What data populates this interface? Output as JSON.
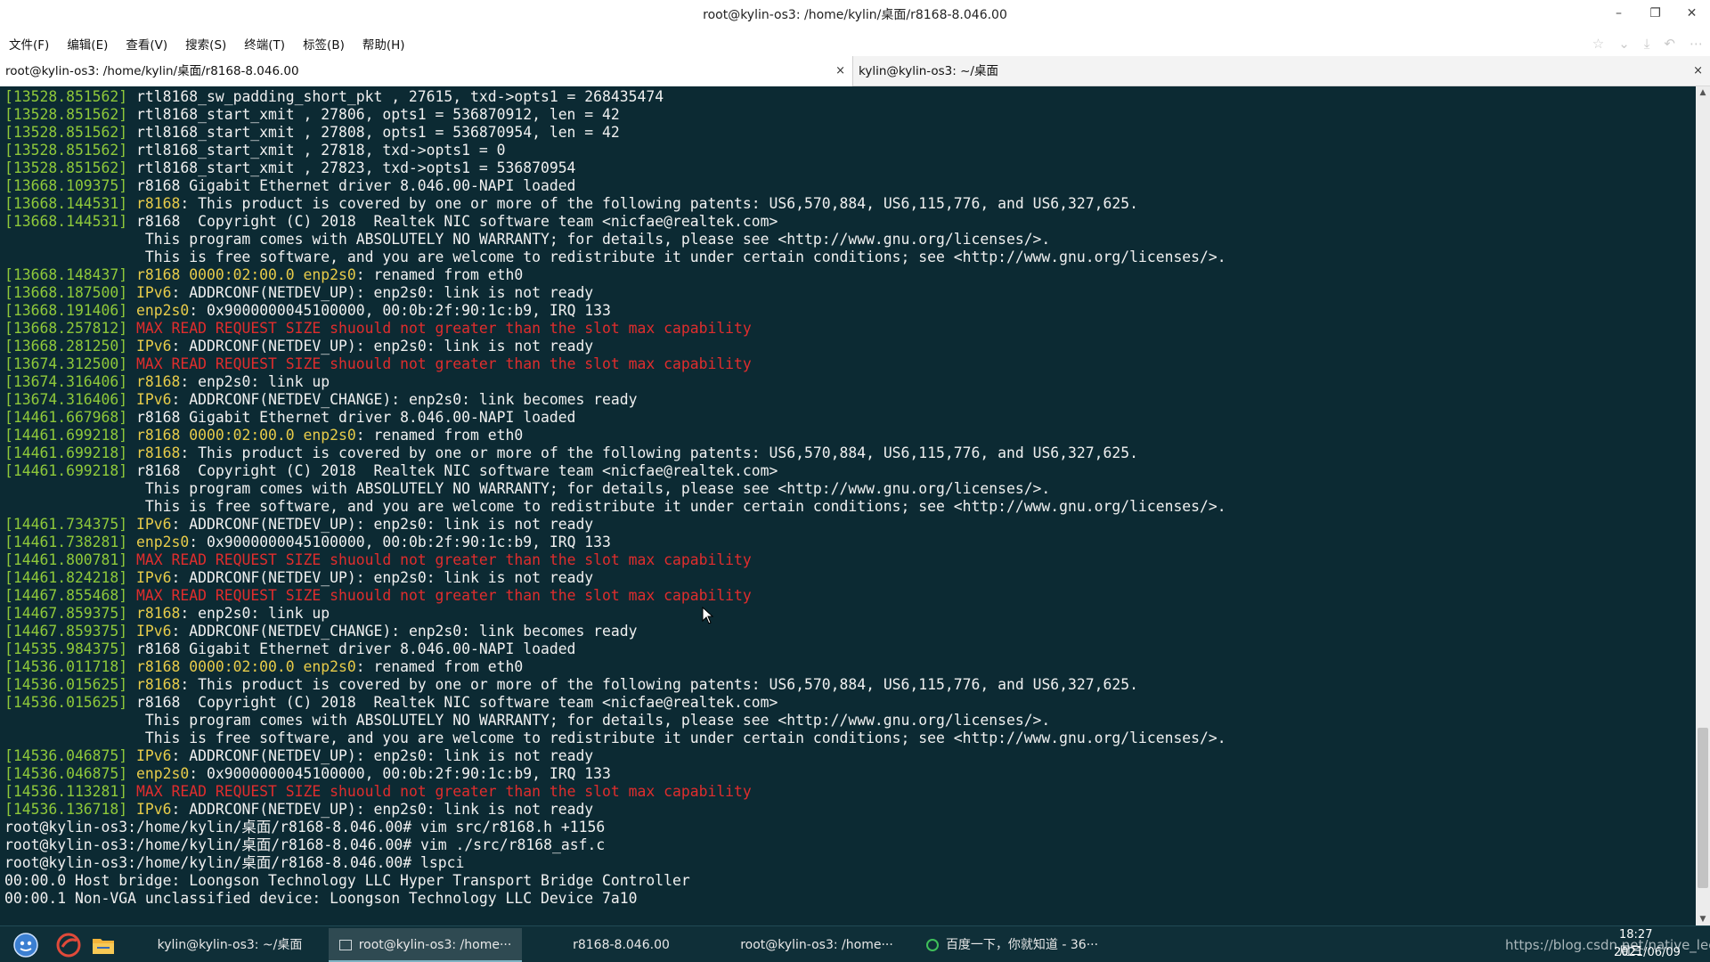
{
  "window": {
    "title": "root@kylin-os3: /home/kylin/桌面/r8168-8.046.00",
    "controls": {
      "minimize": "–",
      "restore": "❐",
      "close": "✕"
    }
  },
  "menu": [
    "文件(F)",
    "编辑(E)",
    "查看(V)",
    "搜索(S)",
    "终端(T)",
    "标签(B)",
    "帮助(H)"
  ],
  "tabs": [
    {
      "label": "root@kylin-os3: /home/kylin/桌面/r8168-8.046.00",
      "active": true
    },
    {
      "label": "kylin@kylin-os3: ~/桌面",
      "active": false
    }
  ],
  "terminal_lines": [
    [
      [
        "ts",
        "[13528.851562]"
      ],
      [
        "t",
        " rtl8168_sw_padding_short_pkt , 27615, txd->opts1 = 268435474"
      ]
    ],
    [
      [
        "ts",
        "[13528.851562]"
      ],
      [
        "t",
        " rtl8168_start_xmit , 27806, opts1 = 536870912, len = 42"
      ]
    ],
    [
      [
        "ts",
        "[13528.851562]"
      ],
      [
        "t",
        " rtl8168_start_xmit , 27808, opts1 = 536870954, len = 42"
      ]
    ],
    [
      [
        "ts",
        "[13528.851562]"
      ],
      [
        "t",
        " rtl8168_start_xmit , 27818, txd->opts1 = 0"
      ]
    ],
    [
      [
        "ts",
        "[13528.851562]"
      ],
      [
        "t",
        " rtl8168_start_xmit , 27823, txd->opts1 = 536870954"
      ]
    ],
    [
      [
        "ts",
        "[13668.109375]"
      ],
      [
        "t",
        " r8168 Gigabit Ethernet driver 8.046.00-NAPI loaded"
      ]
    ],
    [
      [
        "ts",
        "[13668.144531]"
      ],
      [
        "t",
        " "
      ],
      [
        "kw",
        "r8168"
      ],
      [
        "t",
        ": This product is covered by one or more of the following patents: US6,570,884, US6,115,776, and US6,327,625."
      ]
    ],
    [
      [
        "ts",
        "[13668.144531]"
      ],
      [
        "t",
        " r8168  Copyright (C) 2018  Realtek NIC software team <nicfae@realtek.com>"
      ]
    ],
    [
      [
        "t",
        "                This program comes with ABSOLUTELY NO WARRANTY; for details, please see <http://www.gnu.org/licenses/>."
      ]
    ],
    [
      [
        "t",
        "                This is free software, and you are welcome to redistribute it under certain conditions; see <http://www.gnu.org/licenses/>."
      ]
    ],
    [
      [
        "ts",
        "[13668.148437]"
      ],
      [
        "t",
        " "
      ],
      [
        "kw",
        "r8168 0000:02:00.0 enp2s0"
      ],
      [
        "t",
        ": renamed from eth0"
      ]
    ],
    [
      [
        "ts",
        "[13668.187500]"
      ],
      [
        "t",
        " "
      ],
      [
        "kw",
        "IPv6"
      ],
      [
        "t",
        ": ADDRCONF(NETDEV_UP): enp2s0: link is not ready"
      ]
    ],
    [
      [
        "ts",
        "[13668.191406]"
      ],
      [
        "t",
        " "
      ],
      [
        "kw",
        "enp2s0"
      ],
      [
        "t",
        ": 0x9000000045100000, 00:0b:2f:90:1c:b9, IRQ 133"
      ]
    ],
    [
      [
        "ts",
        "[13668.257812]"
      ],
      [
        "t",
        " "
      ],
      [
        "err",
        "MAX READ REQUEST SIZE shuould not greater than the slot max capability"
      ]
    ],
    [
      [
        "ts",
        "[13668.281250]"
      ],
      [
        "t",
        " "
      ],
      [
        "kw",
        "IPv6"
      ],
      [
        "t",
        ": ADDRCONF(NETDEV_UP): enp2s0: link is not ready"
      ]
    ],
    [
      [
        "ts",
        "[13674.312500]"
      ],
      [
        "t",
        " "
      ],
      [
        "err",
        "MAX READ REQUEST SIZE shuould not greater than the slot max capability"
      ]
    ],
    [
      [
        "ts",
        "[13674.316406]"
      ],
      [
        "t",
        " "
      ],
      [
        "kw",
        "r8168"
      ],
      [
        "t",
        ": enp2s0: link up"
      ]
    ],
    [
      [
        "ts",
        "[13674.316406]"
      ],
      [
        "t",
        " "
      ],
      [
        "kw",
        "IPv6"
      ],
      [
        "t",
        ": ADDRCONF(NETDEV_CHANGE): enp2s0: link becomes ready"
      ]
    ],
    [
      [
        "ts",
        "[14461.667968]"
      ],
      [
        "t",
        " r8168 Gigabit Ethernet driver 8.046.00-NAPI loaded"
      ]
    ],
    [
      [
        "ts",
        "[14461.699218]"
      ],
      [
        "t",
        " "
      ],
      [
        "kw",
        "r8168 0000:02:00.0 enp2s0"
      ],
      [
        "t",
        ": renamed from eth0"
      ]
    ],
    [
      [
        "ts",
        "[14461.699218]"
      ],
      [
        "t",
        " "
      ],
      [
        "kw",
        "r8168"
      ],
      [
        "t",
        ": This product is covered by one or more of the following patents: US6,570,884, US6,115,776, and US6,327,625."
      ]
    ],
    [
      [
        "ts",
        "[14461.699218]"
      ],
      [
        "t",
        " r8168  Copyright (C) 2018  Realtek NIC software team <nicfae@realtek.com>"
      ]
    ],
    [
      [
        "t",
        "                This program comes with ABSOLUTELY NO WARRANTY; for details, please see <http://www.gnu.org/licenses/>."
      ]
    ],
    [
      [
        "t",
        "                This is free software, and you are welcome to redistribute it under certain conditions; see <http://www.gnu.org/licenses/>."
      ]
    ],
    [
      [
        "ts",
        "[14461.734375]"
      ],
      [
        "t",
        " "
      ],
      [
        "kw",
        "IPv6"
      ],
      [
        "t",
        ": ADDRCONF(NETDEV_UP): enp2s0: link is not ready"
      ]
    ],
    [
      [
        "ts",
        "[14461.738281]"
      ],
      [
        "t",
        " "
      ],
      [
        "kw",
        "enp2s0"
      ],
      [
        "t",
        ": 0x9000000045100000, 00:0b:2f:90:1c:b9, IRQ 133"
      ]
    ],
    [
      [
        "ts",
        "[14461.800781]"
      ],
      [
        "t",
        " "
      ],
      [
        "err",
        "MAX READ REQUEST SIZE shuould not greater than the slot max capability"
      ]
    ],
    [
      [
        "ts",
        "[14461.824218]"
      ],
      [
        "t",
        " "
      ],
      [
        "kw",
        "IPv6"
      ],
      [
        "t",
        ": ADDRCONF(NETDEV_UP): enp2s0: link is not ready"
      ]
    ],
    [
      [
        "ts",
        "[14467.855468]"
      ],
      [
        "t",
        " "
      ],
      [
        "err",
        "MAX READ REQUEST SIZE shuould not greater than the slot max capability"
      ]
    ],
    [
      [
        "ts",
        "[14467.859375]"
      ],
      [
        "t",
        " "
      ],
      [
        "kw",
        "r8168"
      ],
      [
        "t",
        ": enp2s0: link up"
      ]
    ],
    [
      [
        "ts",
        "[14467.859375]"
      ],
      [
        "t",
        " "
      ],
      [
        "kw",
        "IPv6"
      ],
      [
        "t",
        ": ADDRCONF(NETDEV_CHANGE): enp2s0: link becomes ready"
      ]
    ],
    [
      [
        "ts",
        "[14535.984375]"
      ],
      [
        "t",
        " r8168 Gigabit Ethernet driver 8.046.00-NAPI loaded"
      ]
    ],
    [
      [
        "ts",
        "[14536.011718]"
      ],
      [
        "t",
        " "
      ],
      [
        "kw",
        "r8168 0000:02:00.0 enp2s0"
      ],
      [
        "t",
        ": renamed from eth0"
      ]
    ],
    [
      [
        "ts",
        "[14536.015625]"
      ],
      [
        "t",
        " "
      ],
      [
        "kw",
        "r8168"
      ],
      [
        "t",
        ": This product is covered by one or more of the following patents: US6,570,884, US6,115,776, and US6,327,625."
      ]
    ],
    [
      [
        "ts",
        "[14536.015625]"
      ],
      [
        "t",
        " r8168  Copyright (C) 2018  Realtek NIC software team <nicfae@realtek.com>"
      ]
    ],
    [
      [
        "t",
        "                This program comes with ABSOLUTELY NO WARRANTY; for details, please see <http://www.gnu.org/licenses/>."
      ]
    ],
    [
      [
        "t",
        "                This is free software, and you are welcome to redistribute it under certain conditions; see <http://www.gnu.org/licenses/>."
      ]
    ],
    [
      [
        "ts",
        "[14536.046875]"
      ],
      [
        "t",
        " "
      ],
      [
        "kw",
        "IPv6"
      ],
      [
        "t",
        ": ADDRCONF(NETDEV_UP): enp2s0: link is not ready"
      ]
    ],
    [
      [
        "ts",
        "[14536.046875]"
      ],
      [
        "t",
        " "
      ],
      [
        "kw",
        "enp2s0"
      ],
      [
        "t",
        ": 0x9000000045100000, 00:0b:2f:90:1c:b9, IRQ 133"
      ]
    ],
    [
      [
        "ts",
        "[14536.113281]"
      ],
      [
        "t",
        " "
      ],
      [
        "err",
        "MAX READ REQUEST SIZE shuould not greater than the slot max capability"
      ]
    ],
    [
      [
        "ts",
        "[14536.136718]"
      ],
      [
        "t",
        " "
      ],
      [
        "kw",
        "IPv6"
      ],
      [
        "t",
        ": ADDRCONF(NETDEV_UP): enp2s0: link is not ready"
      ]
    ],
    [
      [
        "t",
        "root@kylin-os3:/home/kylin/桌面/r8168-8.046.00# vim src/r8168.h +1156"
      ]
    ],
    [
      [
        "t",
        "root@kylin-os3:/home/kylin/桌面/r8168-8.046.00# vim ./src/r8168_asf.c"
      ]
    ],
    [
      [
        "t",
        "root@kylin-os3:/home/kylin/桌面/r8168-8.046.00# lspci"
      ]
    ],
    [
      [
        "t",
        "00:00.0 Host bridge: Loongson Technology LLC Hyper Transport Bridge Controller"
      ]
    ],
    [
      [
        "t",
        "00:00.1 Non-VGA unclassified device: Loongson Technology LLC Device 7a10"
      ]
    ]
  ],
  "taskbar": {
    "tasks": [
      {
        "label": "kylin@kylin-os3: ~/桌面",
        "active": false
      },
      {
        "label": "root@kylin-os3: /home···",
        "active": true
      },
      {
        "label": "r8168-8.046.00",
        "active": false
      },
      {
        "label": "root@kylin-os3: /home···",
        "active": false
      },
      {
        "label": "百度一下，你就知道 - 36···",
        "active": false
      }
    ],
    "watermark": "https://blog.csdn.net/native_lee",
    "time": "18:27 周三",
    "date": "2021/06/09"
  },
  "colors": {
    "terminal_bg": "#0c2a33",
    "timestamp": "#8fc93a",
    "keyword": "#e8cc4a",
    "error": "#e02d2d",
    "text": "#f0f0f0"
  }
}
